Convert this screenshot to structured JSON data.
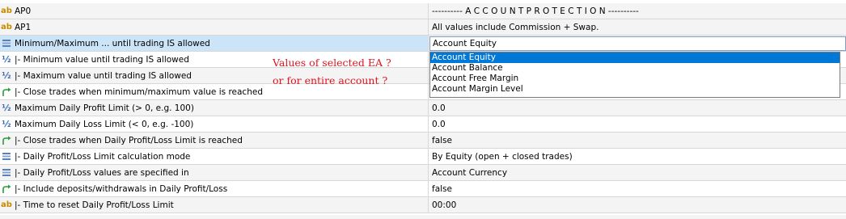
{
  "rows": [
    {
      "icon": "ab",
      "label": "AP0",
      "value": "---------- A C C O U N T   P R O T E C T I O N ----------"
    },
    {
      "icon": "ab",
      "label": "AP1",
      "value": "All values include Commission + Swap."
    },
    {
      "icon": "list",
      "label": "Minimum/Maximum ... until trading IS allowed",
      "value": "Account Equity"
    },
    {
      "icon": "half",
      "label": "|- Minimum value until trading IS allowed",
      "value": ""
    },
    {
      "icon": "half",
      "label": "|- Maximum value until trading IS allowed",
      "value": ""
    },
    {
      "icon": "arrow",
      "label": "|- Close trades when minimum/maximum value is reached",
      "value": ""
    },
    {
      "icon": "half",
      "label": "Maximum Daily Profit Limit (> 0, e.g. 100)",
      "value": "0.0"
    },
    {
      "icon": "half",
      "label": "Maximum Daily Loss Limit (< 0, e.g. -100)",
      "value": "0.0"
    },
    {
      "icon": "arrow",
      "label": "|- Close trades when Daily Profit/Loss Limit is reached",
      "value": "false"
    },
    {
      "icon": "list",
      "label": "|- Daily Profit/Loss Limit calculation mode",
      "value": "By Equity (open + closed trades)"
    },
    {
      "icon": "list",
      "label": "|- Daily Profit/Loss values are specified in",
      "value": "Account Currency"
    },
    {
      "icon": "arrow",
      "label": "|- Include deposits/withdrawals in Daily Profit/Loss",
      "value": "false"
    },
    {
      "icon": "ab",
      "label": "|- Time to reset Daily Profit/Loss Limit",
      "value": "00:00"
    }
  ],
  "dropdown": {
    "options": [
      "Account Equity",
      "Account Balance",
      "Account Free Margin",
      "Account Margin Level"
    ],
    "selected": "Account Equity"
  },
  "annotation": {
    "line1": "Values of selected EA ?",
    "line2": "or for entire account ?"
  },
  "colors": {
    "annotation": "#e0141e",
    "selection": "#0078d7",
    "row_highlight": "#cce4f7",
    "icon_ab": "#c98a00",
    "icon_half": "#3a68b0",
    "icon_arrow": "#2a9a3a"
  }
}
